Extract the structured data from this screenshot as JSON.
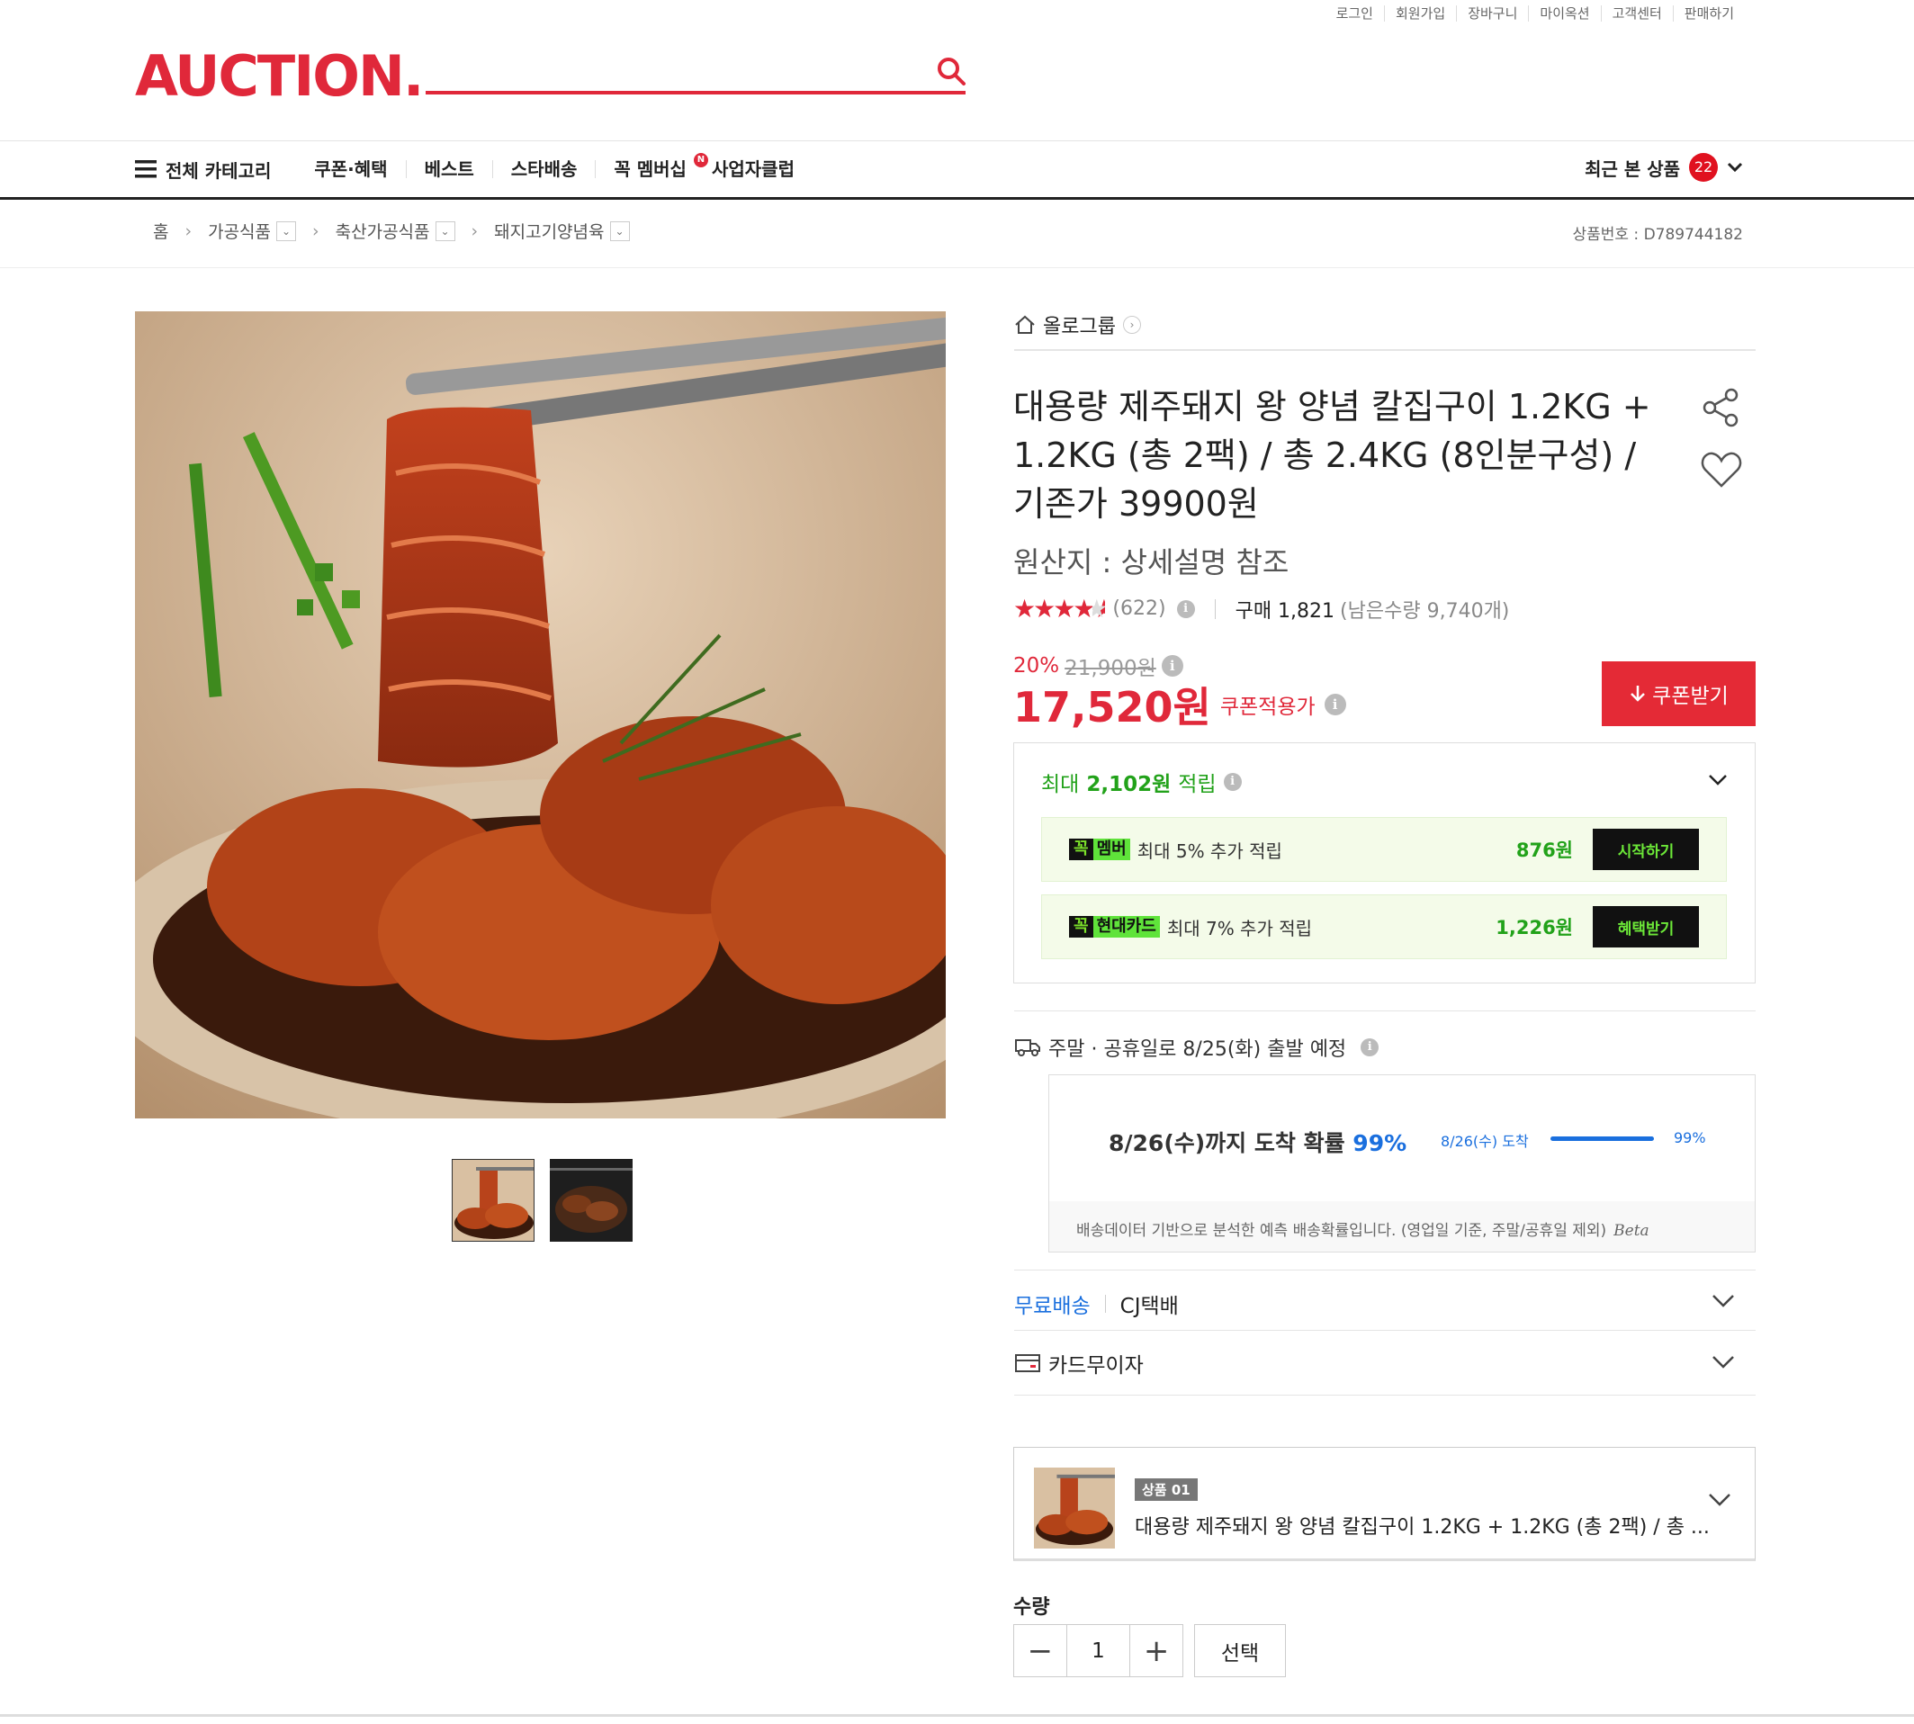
{
  "util_links": [
    "로그인",
    "회원가입",
    "장바구니",
    "마이옥션",
    "고객센터",
    "판매하기"
  ],
  "logo": "AUCTION.",
  "gnb": {
    "all_category": "전체 카테고리",
    "items": [
      "쿠폰·혜택",
      "베스트",
      "스타배송",
      "꼭 멤버십",
      "사업자클럽"
    ],
    "new_badge": "N",
    "recent_label": "최근 본 상품",
    "recent_count": "22"
  },
  "breadcrumb": [
    "홈",
    "가공식품",
    "축산가공식품",
    "돼지고기양념육"
  ],
  "product_no": "상품번호 : D789744182",
  "seller": "올로그룹",
  "title": "대용량 제주돼지 왕 양념 칼집구이 1.2KG + 1.2KG (총 2팩) / 총 2.4KG (8인분구성) / 기존가 39900원",
  "origin": "원산지 : 상세설명 참조",
  "rating": {
    "stars_value": 4.5,
    "count": "(622)",
    "purchase": "구매 1,821",
    "remaining": "(남은수량 9,740개)"
  },
  "price": {
    "discount_rate": "20%",
    "original": "21,900원",
    "final": "17,520원",
    "final_label": "쿠폰적용가",
    "coupon_button": "쿠폰받기"
  },
  "points": {
    "title_prefix": "최대",
    "title_amount": "2,102원",
    "title_suffix": "적립",
    "rows": [
      {
        "badge_a": "꼭",
        "badge_b": "멤버",
        "desc": "최대 5% 추가 적립",
        "amount": "876원",
        "button": "시작하기"
      },
      {
        "badge_a": "꼭",
        "badge_b": "현대카드",
        "desc": "최대 7% 추가 적립",
        "amount": "1,226원",
        "button": "혜택받기"
      }
    ]
  },
  "shipping": {
    "notice": "주말 · 공휴일로 8/25(화) 출발 예정",
    "eta_main": "8/26(수)까지 도착 확률",
    "eta_pct": "99%",
    "eta_mini_label": "8/26(수) 도착",
    "eta_mini_pct": "99%",
    "eta_mini_value": 0.99,
    "eta_note": "배송데이터 기반으로 분석한 예측 배송확률입니다. (영업일 기준, 주말/공휴일 제외)",
    "beta": "Beta",
    "free": "무료배송",
    "carrier": "CJ택배",
    "card": "카드무이자"
  },
  "option": {
    "badge": "상품 01",
    "name": "대용량 제주돼지 왕 양념 칼집구이 1.2KG + 1.2KG (총 2팩) / 총 ..."
  },
  "quantity": {
    "label": "수량",
    "value": "1",
    "minus": "−",
    "plus": "+",
    "select": "선택"
  }
}
